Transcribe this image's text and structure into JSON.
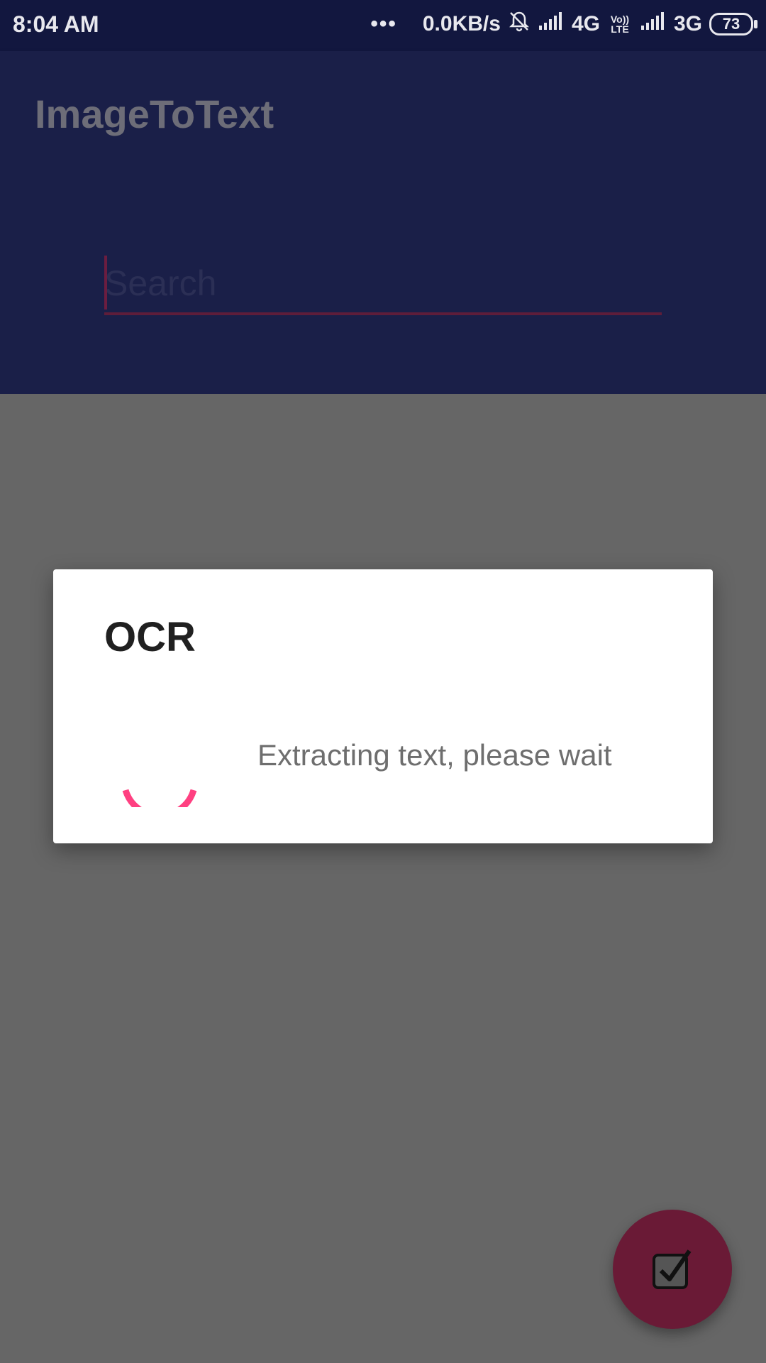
{
  "status_bar": {
    "time": "8:04 AM",
    "more": "•••",
    "speed": "0.0KB/s",
    "network1": "4G",
    "volte": "Vo)) LTE",
    "network2": "3G",
    "battery": "73"
  },
  "app_bar": {
    "title": "ImageToText"
  },
  "search": {
    "placeholder": "Search",
    "value": ""
  },
  "dialog": {
    "title": "OCR",
    "message": "Extracting text, please wait"
  },
  "icons": {
    "fab": "checkbox-checked-icon",
    "status": [
      "bell-off-icon",
      "signal-icon",
      "battery-icon"
    ]
  },
  "colors": {
    "status_bar": "#12173f",
    "app_bar": "#1a1f48",
    "accent": "#ff4081",
    "fab": "#6a1a36",
    "scrim": "#666666"
  }
}
